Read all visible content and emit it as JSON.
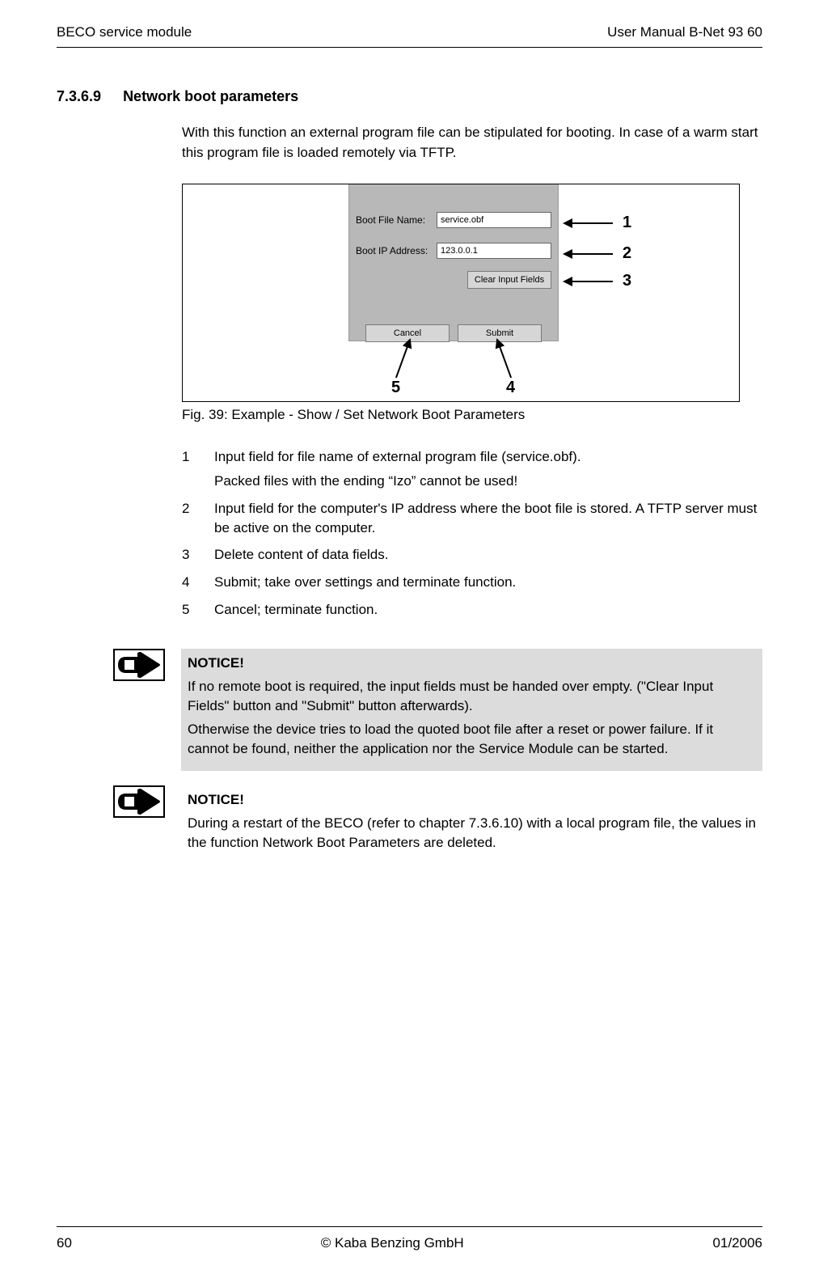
{
  "header": {
    "left": "BECO service module",
    "right": "User Manual B-Net 93 60"
  },
  "section": {
    "number": "7.3.6.9",
    "title": "Network boot parameters"
  },
  "intro": "With this function an external program file can be stipulated for booting. In case of a warm start this program file is loaded remotely via TFTP.",
  "ui": {
    "boot_file_label": "Boot File Name:",
    "boot_file_value": "service.obf",
    "boot_ip_label": "Boot IP Address:",
    "boot_ip_value": "123.0.0.1",
    "clear_btn": "Clear Input Fields",
    "cancel_btn": "Cancel",
    "submit_btn": "Submit",
    "callouts": {
      "c1": "1",
      "c2": "2",
      "c3": "3",
      "c4": "4",
      "c5": "5"
    }
  },
  "fig_caption": "Fig. 39: Example - Show / Set Network Boot Parameters",
  "list": {
    "i1n": "1",
    "i1a": "Input field for file name of external program file (service.obf).",
    "i1b": "Packed files with the ending “Izo” cannot be used!",
    "i2n": "2",
    "i2": "Input field for the computer's IP address where the boot file is stored. A TFTP server must be active on the computer.",
    "i3n": "3",
    "i3": "Delete content of data fields.",
    "i4n": "4",
    "i4": "Submit; take over settings and terminate function.",
    "i5n": "5",
    "i5": "Cancel; terminate function."
  },
  "notice1": {
    "title": "NOTICE!",
    "p1": "If no remote boot is required, the input fields must be handed over empty. (\"Clear Input Fields\" button and \"Submit\" button afterwards).",
    "p2": "Otherwise the device tries to load the quoted boot file after a reset or power failure. If it cannot be found, neither the application nor the Service Module can be started."
  },
  "notice2": {
    "title": "NOTICE!",
    "p1": "During a restart of the BECO (refer to chapter 7.3.6.10) with a local program file, the values in the function Network Boot Parameters are deleted."
  },
  "footer": {
    "left": "60",
    "center": "© Kaba Benzing GmbH",
    "right": "01/2006"
  }
}
